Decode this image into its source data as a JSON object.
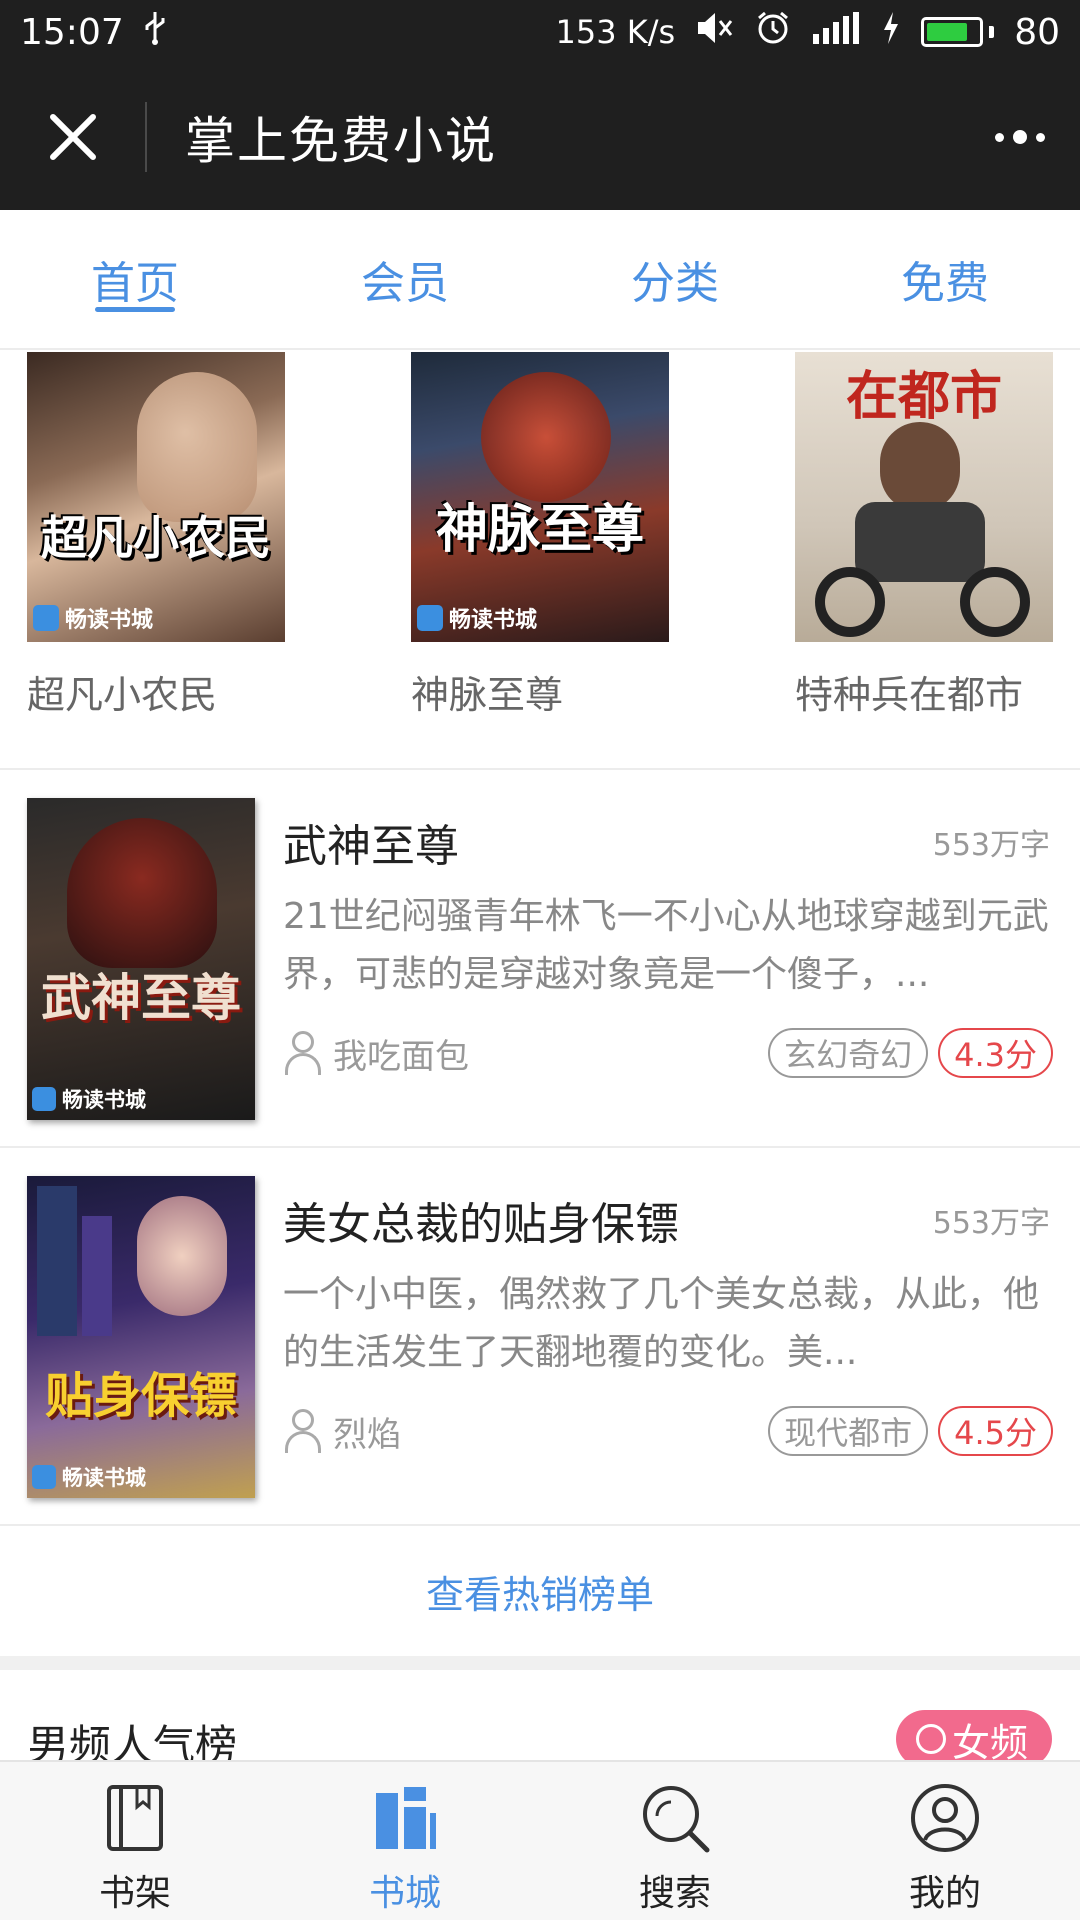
{
  "status_bar": {
    "time": "15:07",
    "net_speed": "153 K/s",
    "battery": "80"
  },
  "title_bar": {
    "title": "掌上免费小说"
  },
  "top_tabs": [
    {
      "label": "首页",
      "active": true
    },
    {
      "label": "会员",
      "active": false
    },
    {
      "label": "分类",
      "active": false
    },
    {
      "label": "免费",
      "active": false
    }
  ],
  "carousel": [
    {
      "name": "超凡小农民",
      "cover_title": "超凡小农民",
      "badge": "畅读书城"
    },
    {
      "name": "神脉至尊",
      "cover_title": "神脉至尊",
      "badge": "畅读书城"
    },
    {
      "name": "特种兵在都市",
      "cover_title": "在都市",
      "badge": ""
    }
  ],
  "books": [
    {
      "name": "武神至尊",
      "words": "553万字",
      "desc": "21世纪闷骚青年林飞一不小心从地球穿越到元武界，可悲的是穿越对象竟是一个傻子，...",
      "author": "我吃面包",
      "genre": "玄幻奇幻",
      "score": "4.3分",
      "cover_title": "武神至尊",
      "badge": "畅读书城"
    },
    {
      "name": "美女总裁的贴身保镖",
      "words": "553万字",
      "desc": "一个小中医，偶然救了几个美女总裁，从此，他的生活发生了天翻地覆的变化。美...",
      "author": "烈焰",
      "genre": "现代都市",
      "score": "4.5分",
      "cover_title": "贴身保镖",
      "badge": "畅读书城"
    }
  ],
  "hot_link": "查看热销榜单",
  "rank": {
    "title": "男频人气榜",
    "switch_label": "女频"
  },
  "bottom_nav": [
    {
      "label": "书架",
      "icon": "bookshelf-icon",
      "active": false
    },
    {
      "label": "书城",
      "icon": "bookstore-icon",
      "active": true
    },
    {
      "label": "搜索",
      "icon": "search-icon",
      "active": false
    },
    {
      "label": "我的",
      "icon": "profile-icon",
      "active": false
    }
  ],
  "colors": {
    "accent": "#4a90e2",
    "score": "#e5474b",
    "switch": "#f26a8d",
    "dark_bar": "#1f1f1f"
  }
}
